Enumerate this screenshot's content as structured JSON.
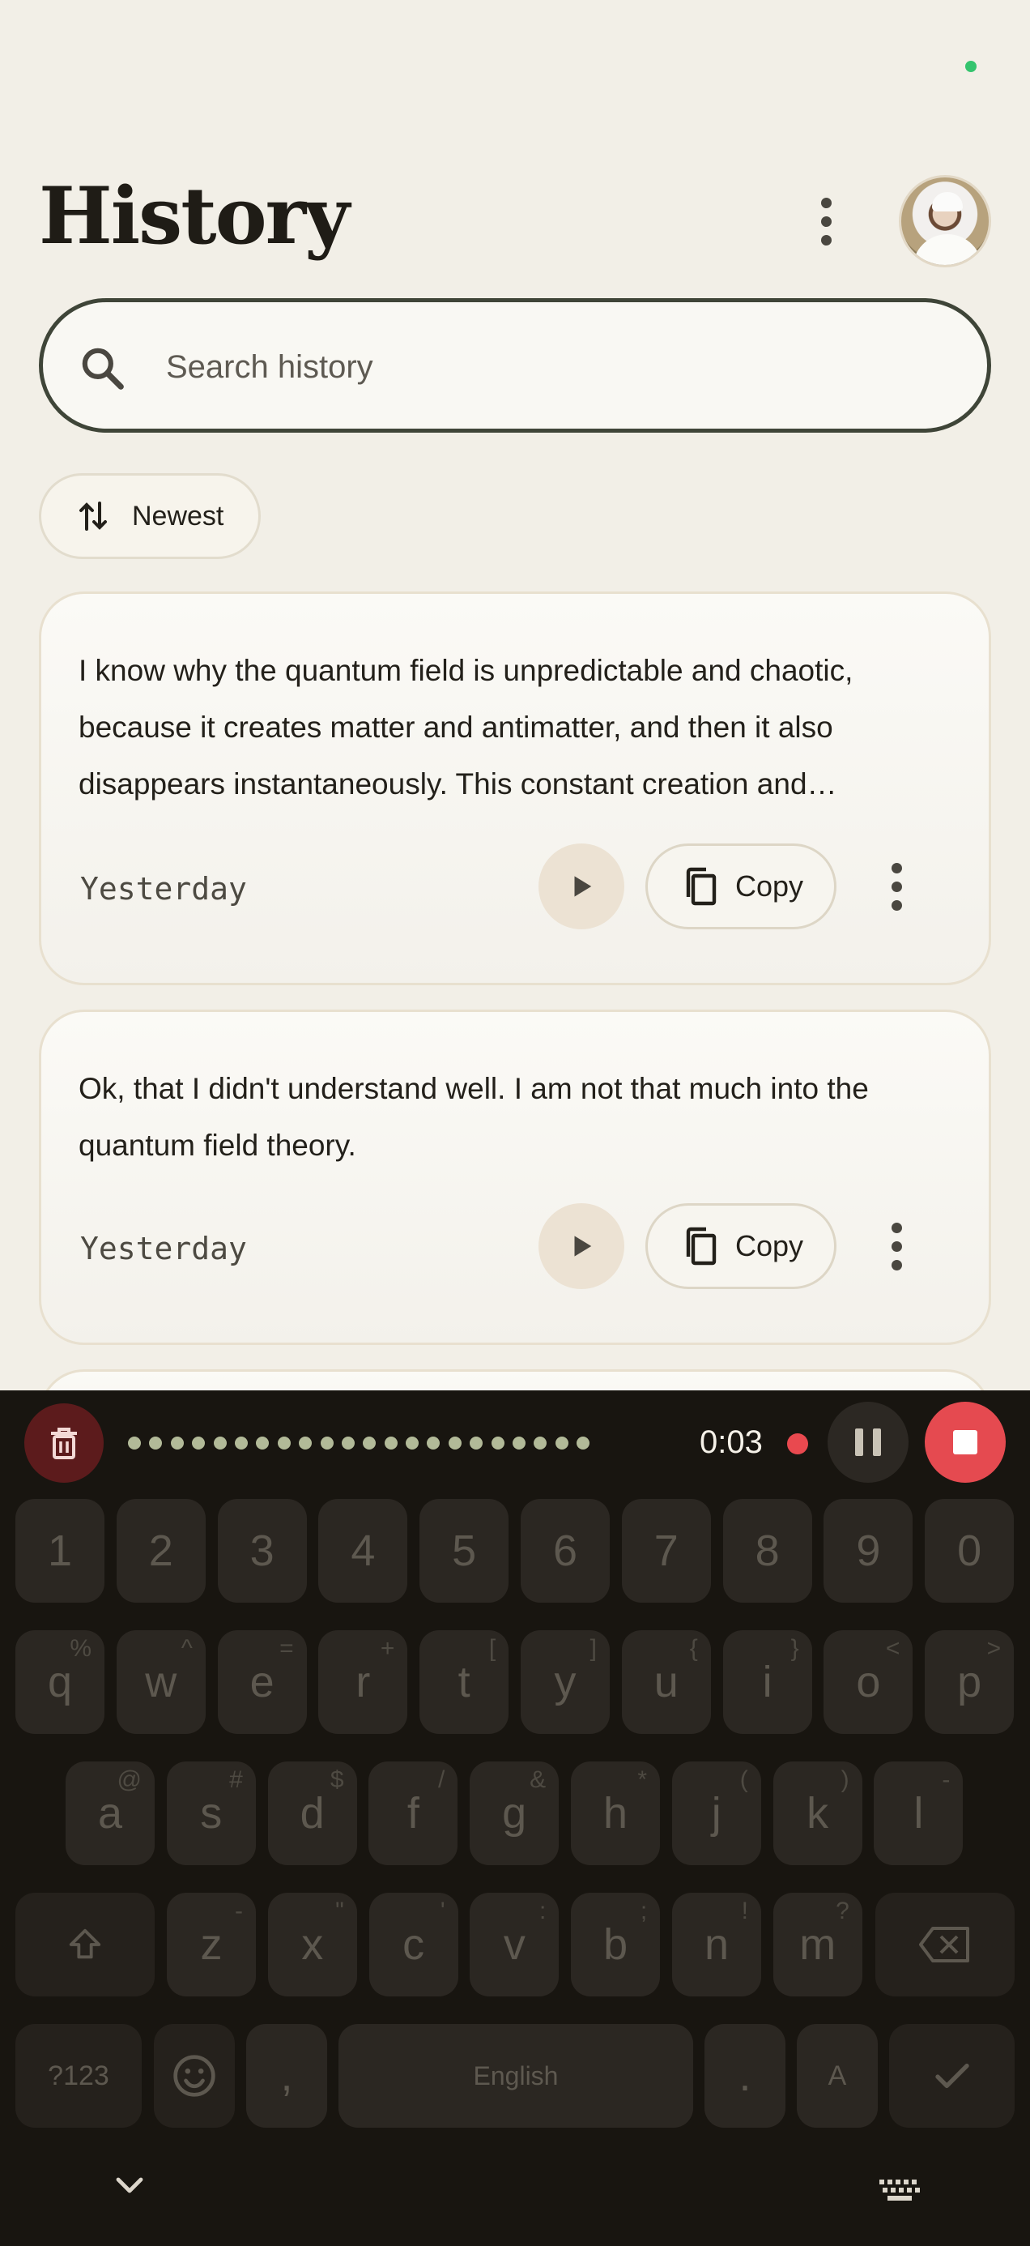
{
  "header": {
    "title": "History"
  },
  "search": {
    "placeholder": "Search history"
  },
  "sort": {
    "label": "Newest"
  },
  "cards": [
    {
      "text": "I know why the quantum field is unpredictable and chaotic, because it creates matter and antimatter, and then it also disappears instantaneously. This constant creation and disappearance",
      "date": "Yesterday",
      "copy_label": "Copy"
    },
    {
      "text": "Ok, that I didn't understand well. I am not that much into the quantum field theory.",
      "date": "Yesterday",
      "copy_label": "Copy"
    }
  ],
  "recorder": {
    "timer": "0:03"
  },
  "keyboard": {
    "number_row": [
      "1",
      "2",
      "3",
      "4",
      "5",
      "6",
      "7",
      "8",
      "9",
      "0"
    ],
    "row1": [
      {
        "k": "q",
        "s": "%"
      },
      {
        "k": "w",
        "s": "^"
      },
      {
        "k": "e",
        "s": "="
      },
      {
        "k": "r",
        "s": "+"
      },
      {
        "k": "t",
        "s": "["
      },
      {
        "k": "y",
        "s": "]"
      },
      {
        "k": "u",
        "s": "{"
      },
      {
        "k": "i",
        "s": "}"
      },
      {
        "k": "o",
        "s": "<"
      },
      {
        "k": "p",
        "s": ">"
      }
    ],
    "row2": [
      {
        "k": "a",
        "s": "@"
      },
      {
        "k": "s",
        "s": "#"
      },
      {
        "k": "d",
        "s": "$"
      },
      {
        "k": "f",
        "s": "/"
      },
      {
        "k": "g",
        "s": "&"
      },
      {
        "k": "h",
        "s": "*"
      },
      {
        "k": "j",
        "s": "("
      },
      {
        "k": "k",
        "s": ")"
      },
      {
        "k": "l",
        "s": "-"
      }
    ],
    "row3": [
      {
        "k": "z",
        "s": "-"
      },
      {
        "k": "x",
        "s": "\""
      },
      {
        "k": "c",
        "s": "'"
      },
      {
        "k": "v",
        "s": ":"
      },
      {
        "k": "b",
        "s": ";"
      },
      {
        "k": "n",
        "s": "!"
      },
      {
        "k": "m",
        "s": "?"
      }
    ],
    "symbols_label": "?123",
    "comma": ",",
    "space_label": "English",
    "period": ".",
    "caps_label": "A"
  }
}
